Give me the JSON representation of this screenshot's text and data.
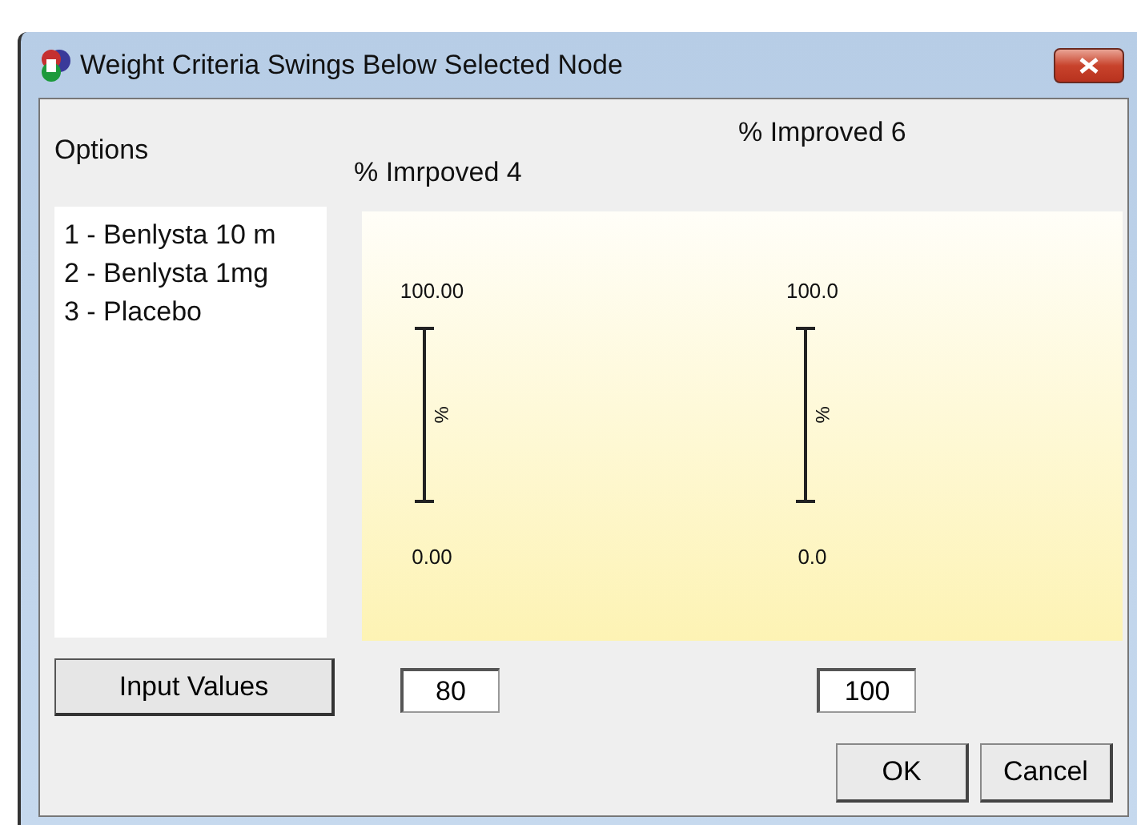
{
  "window": {
    "title": "Weight Criteria Swings Below Selected Node"
  },
  "options_label": "Options",
  "options": [
    "1 - Benlysta 10 m",
    "2 - Benlysta 1mg",
    "3 - Placebo"
  ],
  "criteria": [
    {
      "header": "% Imrpoved 4",
      "max": "100.00",
      "min": "0.00",
      "unit": "%",
      "value": "80"
    },
    {
      "header": "% Improved 6",
      "max": "100.0",
      "min": "0.0",
      "unit": "%",
      "value": "100"
    }
  ],
  "input_button": "Input Values",
  "buttons": [
    "OK",
    "Cancel"
  ]
}
